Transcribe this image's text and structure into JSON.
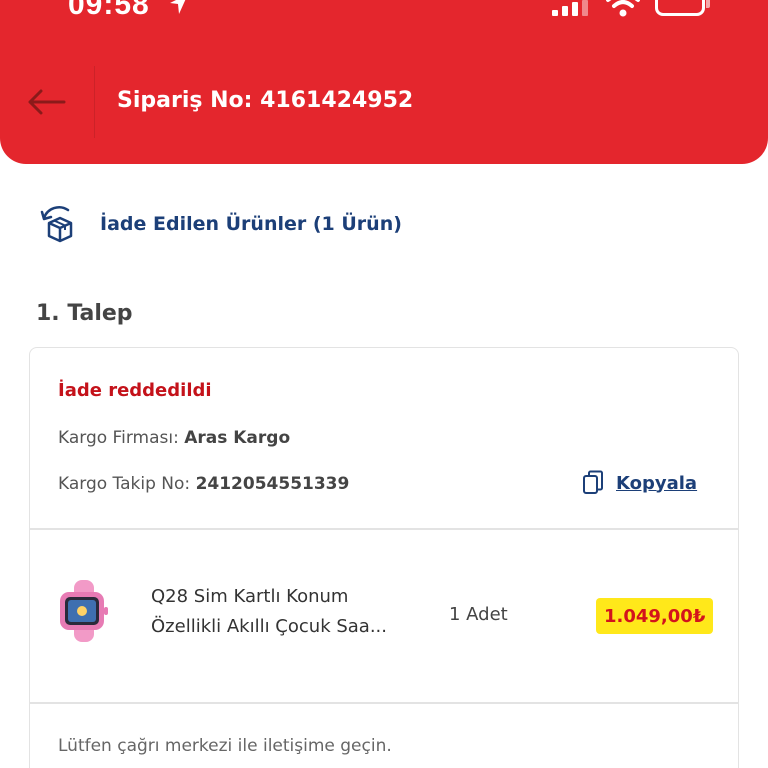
{
  "status_bar": {
    "time": "09:58",
    "colors": {
      "status_text": "#ffffff"
    },
    "icons": [
      "location-arrow-icon",
      "signal-icon",
      "wifi-icon",
      "battery-icon"
    ]
  },
  "header": {
    "order_title": "Sipariş No: 4161424952",
    "back_icon": "arrow-left-icon",
    "colors": {
      "background": "#e4262d",
      "back_arrow": "#8b1a1a"
    }
  },
  "returned_products": {
    "label": "İade Edilen Ürünler (1 Ürün)",
    "icon": "return-box-icon",
    "colors": {
      "text": "#1c3f78"
    }
  },
  "request": {
    "title": "1. Talep",
    "status": "İade reddedildi",
    "cargo_company_label": "Kargo Firması:",
    "cargo_company": "Aras Kargo",
    "tracking_label": "Kargo Takip No:",
    "tracking_number": "2412054551339",
    "copy_label": "Kopyala",
    "copy_icon": "copy-icon",
    "product": {
      "name_line1": "Q28 Sim Kartlı Konum",
      "name_line2": "Özellikli Akıllı Çocuk Saa...",
      "quantity": "1 Adet",
      "price": "1.049,00₺",
      "image_icon": "kids-smartwatch-image"
    },
    "footer_note": "Lütfen çağrı merkezi ile iletişime geçin.",
    "colors": {
      "status_rejected": "#c4121a",
      "price_badge_bg": "#ffe81a",
      "price_text": "#d3131c"
    }
  }
}
